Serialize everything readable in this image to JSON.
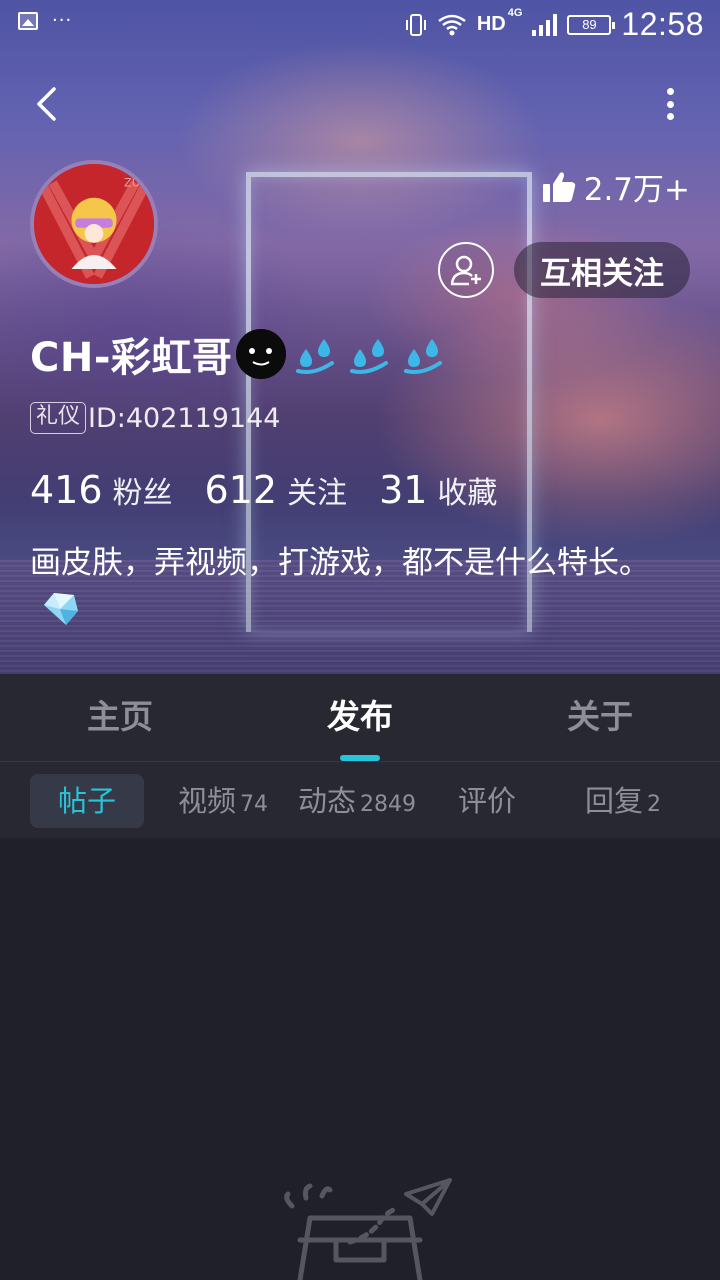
{
  "status_bar": {
    "network": "HD",
    "network_gen": "4G",
    "battery": "89",
    "time": "12:58"
  },
  "profile": {
    "likes": "2.7万+",
    "mutual_follow_label": "互相关注",
    "username": "CH-彩虹哥",
    "badge": "礼仪",
    "user_id": "ID:402119144",
    "stats": [
      {
        "num": "416",
        "label": "粉丝"
      },
      {
        "num": "612",
        "label": "关注"
      },
      {
        "num": "31",
        "label": "收藏"
      }
    ],
    "bio": "画皮肤，弄视频，打游戏，都不是什么特长。"
  },
  "main_tabs": [
    {
      "label": "主页"
    },
    {
      "label": "发布"
    },
    {
      "label": "关于"
    }
  ],
  "main_tab_selected": "发布",
  "sub_tabs": [
    {
      "label": "帖子",
      "count": ""
    },
    {
      "label": "视频",
      "count": "74"
    },
    {
      "label": "动态",
      "count": "2849"
    },
    {
      "label": "评价",
      "count": ""
    },
    {
      "label": "回复",
      "count": "2"
    }
  ],
  "sub_tab_selected": "帖子",
  "colors": {
    "accent": "#28c4d8",
    "tab_bar_bg": "#272832",
    "content_bg": "#1f2029",
    "inactive_text": "#8d8e98"
  },
  "icons": [
    "image-icon",
    "more-notifications-icon",
    "vibrate-icon",
    "wifi-icon",
    "signal-icon",
    "battery-icon",
    "back-arrow-icon",
    "more-vertical-icon",
    "thumbs-up-icon",
    "add-friend-icon",
    "face-emoji-icon",
    "sweat-drops-icon",
    "diamond-icon",
    "empty-box-icon",
    "paper-plane-icon"
  ]
}
